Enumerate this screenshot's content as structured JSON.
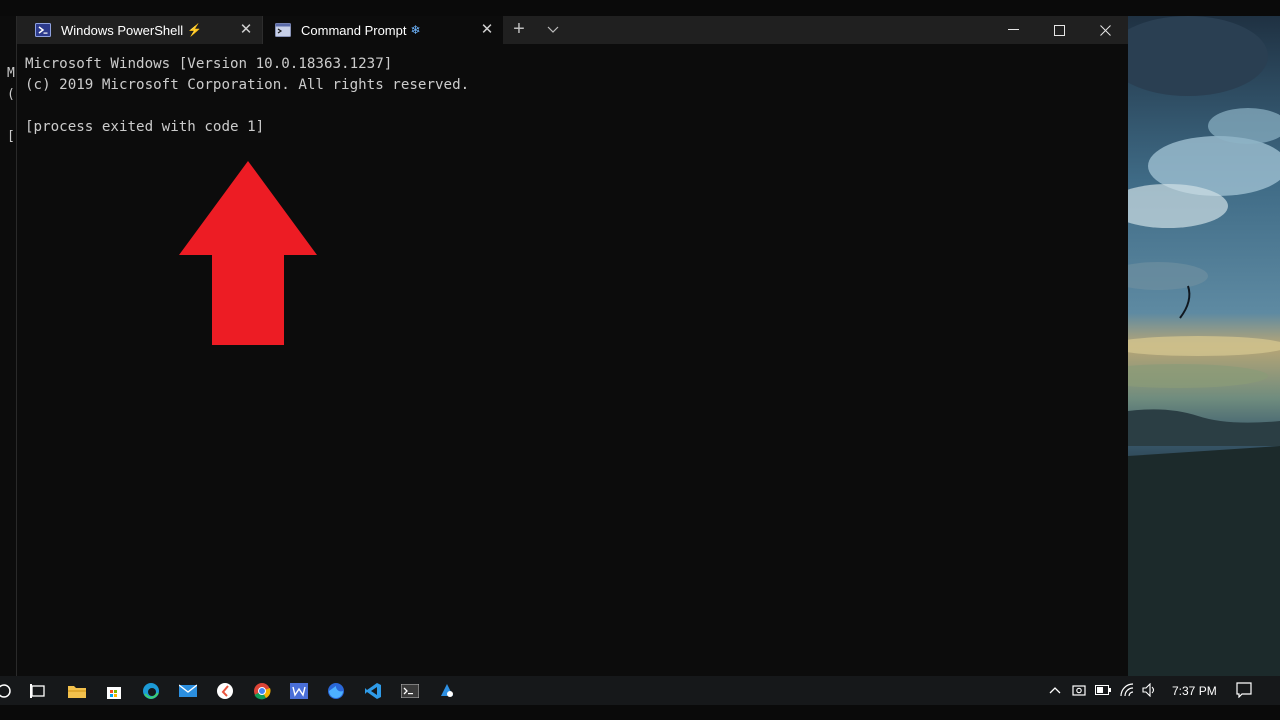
{
  "background_window": {
    "lines": [
      "M",
      "(",
      "",
      "["
    ]
  },
  "terminal": {
    "tabs": [
      {
        "title": "Windows PowerShell",
        "badge": "⚡",
        "icon": "powershell-icon",
        "close": "✕",
        "active": false
      },
      {
        "title": "Command Prompt",
        "badge": "❄",
        "icon": "command-prompt-icon",
        "close": "✕",
        "active": true
      }
    ],
    "new_tab_label": "+",
    "output_lines": [
      "Microsoft Windows [Version 10.0.18363.1237]",
      "(c) 2019 Microsoft Corporation. All rights reserved.",
      "",
      "[process exited with code 1]"
    ]
  },
  "annotation": {
    "icon": "red-up-arrow",
    "color": "#ed1c24"
  },
  "taskbar": {
    "apps": [
      "search-icon",
      "task-view-icon",
      "file-explorer-icon",
      "store-icon",
      "edge-icon",
      "mail-icon",
      "app-icon",
      "chrome-icon",
      "word-icon",
      "firefox-icon",
      "vscode-icon",
      "terminal-icon",
      "settings-icon"
    ],
    "tray": [
      "chevron-up-icon",
      "camera-icon",
      "battery-icon",
      "wifi-icon",
      "volume-icon"
    ],
    "clock": "7:37 PM"
  },
  "colors": {
    "accent_red": "#ed1c24",
    "console_fg": "#cccccc",
    "titlebar": "#202020"
  }
}
